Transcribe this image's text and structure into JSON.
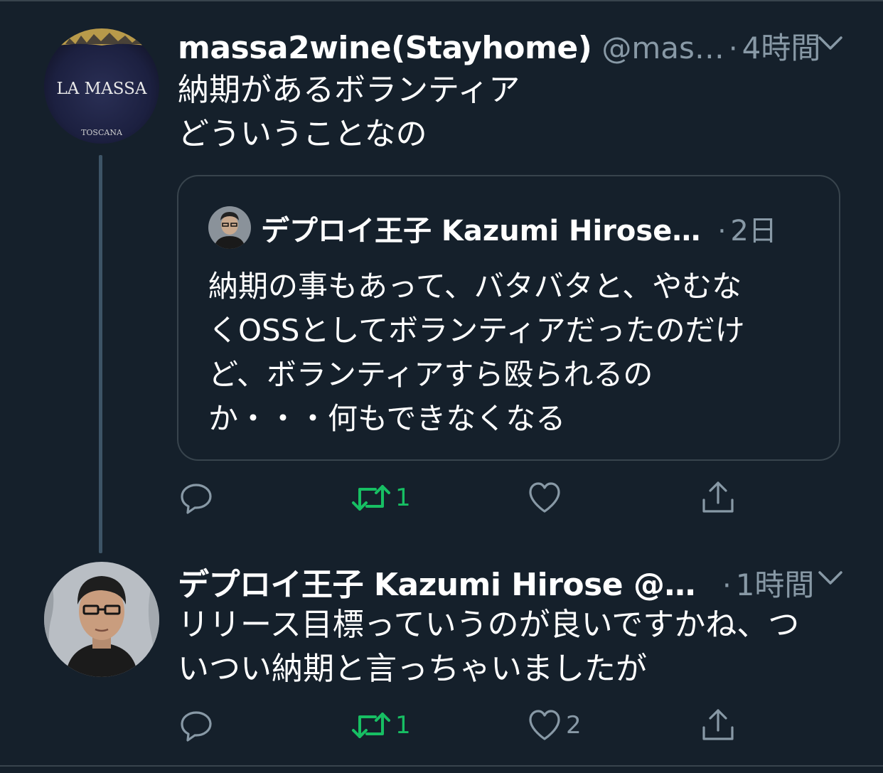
{
  "colors": {
    "background": "#15202b",
    "border": "#38444d",
    "secondary_text": "#8899a6",
    "retweet_active": "#17bf63",
    "thread_line": "#3d5466"
  },
  "tweet1": {
    "avatar_label": "LA MASSA",
    "avatar_sublabel": "TOSCANA",
    "name": "massa2wine(Stayhome)",
    "handle": "@mas…",
    "separator": "·",
    "time": "4時間",
    "text_lines": [
      "納期があるボランティア",
      "どういうことなの"
    ],
    "quote": {
      "name": "デプロイ王子 Kazumi Hirose…",
      "separator": "·",
      "time": "2日",
      "text_lines": [
        "納期の事もあって、バタバタと、やむな",
        "くOSSとしてボランティアだったのだけ",
        "ど、ボランティアすら殴られるの",
        "か・・・何もできなくなる"
      ]
    },
    "actions": {
      "reply_icon": "reply-icon",
      "retweet_icon": "retweet-icon",
      "retweet_count": "1",
      "like_icon": "heart-icon",
      "like_count": "",
      "share_icon": "share-icon"
    }
  },
  "tweet2": {
    "name": "デプロイ王子 Kazumi Hirose @…",
    "separator": "·",
    "time": "1時間",
    "text_lines": [
      "リリース目標っていうのが良いですかね、つ",
      "いつい納期と言っちゃいましたが"
    ],
    "actions": {
      "reply_icon": "reply-icon",
      "retweet_icon": "retweet-icon",
      "retweet_count": "1",
      "like_icon": "heart-icon",
      "like_count": "2",
      "share_icon": "share-icon"
    }
  }
}
